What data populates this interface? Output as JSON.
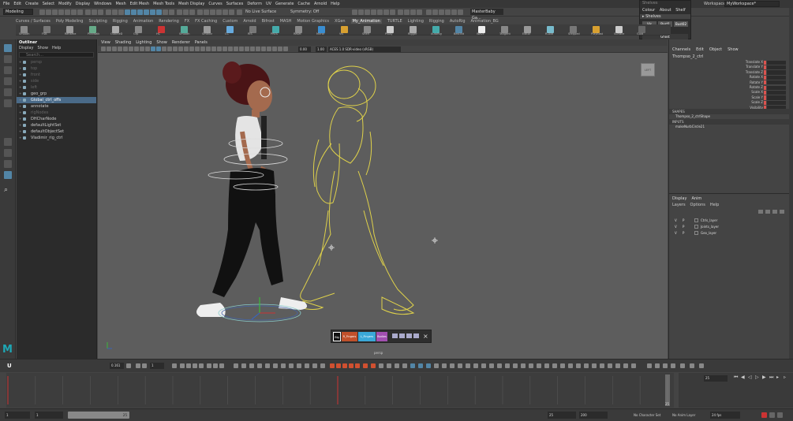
{
  "menubar": [
    "File",
    "Edit",
    "Create",
    "Select",
    "Modify",
    "Display",
    "Windows",
    "Mesh",
    "Edit Mesh",
    "Mesh Tools",
    "Mesh Display",
    "Curves",
    "Surfaces",
    "Deform",
    "UV",
    "Generate",
    "Cache",
    "Arnold",
    "Help"
  ],
  "status_line": {
    "mode": "Modeling",
    "live_surface": "No Live Surface",
    "symmetry": "Symmetry: Off",
    "camera_field": "MasterBaby Ga..."
  },
  "workspace": {
    "label": "Workspace :",
    "value": "MyWorkspace*"
  },
  "float_menu": {
    "header": "Shelves",
    "row1": [
      "Colour",
      "About",
      "Shelf"
    ],
    "section": "Shelves",
    "buttons": [
      "Vis",
      "Bust1",
      "Bust02"
    ],
    "ghost": "Ghost"
  },
  "shelf_tabs": [
    "Curves / Surfaces",
    "Poly Modeling",
    "Sculpting",
    "Rigging",
    "Animation",
    "Rendering",
    "FX",
    "FX Caching",
    "Custom",
    "Arnold",
    "Bifrost",
    "MASH",
    "Motion Graphics",
    "XGen",
    "My_Animation",
    "TURTLE",
    "Lighting",
    "Rigging",
    "AutoRig",
    "Animation_BG"
  ],
  "shelf_labels": [
    "Smooth",
    "FSB",
    "Rename",
    "PickWalk",
    "OutlineD",
    "Grp",
    "HC",
    "Smooth",
    "SmthBr",
    "CC",
    "RIS",
    "PRES",
    "Reset",
    "Mirror",
    "Vis",
    "Shelf",
    "Proxy",
    "Rigger",
    "AutoRig",
    "BestVid",
    "Wave",
    "Tangent",
    "Editor",
    "R-Dial",
    "Stepped",
    "PlayBast",
    "Surface",
    "Guid"
  ],
  "outliner": {
    "title": "Outliner",
    "menus": [
      "Display",
      "Show",
      "Help"
    ],
    "search_placeholder": "Search...",
    "items": [
      {
        "label": "persp",
        "dim": true,
        "sel": false
      },
      {
        "label": "top",
        "dim": true,
        "sel": false
      },
      {
        "label": "front",
        "dim": true,
        "sel": false
      },
      {
        "label": "side",
        "dim": true,
        "sel": false
      },
      {
        "label": "left",
        "dim": true,
        "sel": false
      },
      {
        "label": "geo_grp",
        "dim": false,
        "sel": false
      },
      {
        "label": "Global_ctrl_offs",
        "dim": false,
        "sel": true
      },
      {
        "label": "annotate",
        "dim": false,
        "sel": false
      },
      {
        "label": "rigNodes",
        "dim": true,
        "sel": false
      },
      {
        "label": "DHCharNode",
        "dim": false,
        "sel": false
      },
      {
        "label": "defaultLightSet",
        "dim": false,
        "sel": false
      },
      {
        "label": "defaultObjectSet",
        "dim": false,
        "sel": false
      },
      {
        "label": "Vladimir_rig_ctrl",
        "dim": false,
        "sel": false
      }
    ]
  },
  "viewport": {
    "menus": [
      "View",
      "Shading",
      "Lighting",
      "Show",
      "Renderer",
      "Panels"
    ],
    "near_value": "0.00",
    "far_value": "1.00",
    "color_space": "ACES 1.0 SDR-video (sRGB)",
    "camera_label": "persp",
    "view_cube": "LEFT"
  },
  "picker": {
    "buttons": [
      {
        "label": "Big",
        "color": "#111111"
      },
      {
        "label": "R_Fingers",
        "color": "#c0502a"
      },
      {
        "label": "L_Fingers",
        "color": "#3aa8d8"
      },
      {
        "label": "Bodies",
        "color": "#a24fb0"
      }
    ],
    "close": "×"
  },
  "channel_box": {
    "menus": [
      "Channels",
      "Edit",
      "Object",
      "Show"
    ],
    "object_name": "Thompso_2_ctrl",
    "attributes": [
      "Translate X",
      "Translate Y",
      "Translate Z",
      "Rotate X",
      "Rotate Y",
      "Rotate Z",
      "Scale X",
      "Scale Y",
      "Scale Z",
      "Visibility"
    ],
    "shapes_label": "SHAPES",
    "shape_name": "Thompso_2_ctrlShape",
    "inputs_label": "INPUTS",
    "input_name": "makeNurbCircle21"
  },
  "layer_editor": {
    "tabs": [
      "Display",
      "Anim"
    ],
    "menus": [
      "Layers",
      "Options",
      "Help"
    ],
    "layers": [
      {
        "v": "V",
        "p": "P",
        "name": "Ctrls_layer",
        "color": "#444444"
      },
      {
        "v": "V",
        "p": "P",
        "name": "Joints_layer",
        "color": "#444444"
      },
      {
        "v": "V",
        "p": "P",
        "name": "Geo_layer",
        "color": "#444444"
      }
    ]
  },
  "timeline": {
    "current_frame": "25",
    "frame_field": "25",
    "ticks_start": 1,
    "ticks_end": 25
  },
  "range_bar": {
    "start": "1",
    "playback_start": "1",
    "range_end": "25",
    "anim_end": "25",
    "max_end": "200",
    "character_set": "No Character Set",
    "anim_layer": "No Anim Layer",
    "fps": "24 fps"
  },
  "anim_bar": {
    "step_value": "0.161",
    "key_value": "1"
  },
  "logo": "M",
  "colors": {
    "viewport_bg": "#5d5d5d",
    "selection": "#4a6a88",
    "ghost": "#e6d84a",
    "accent": "#5285a6"
  }
}
